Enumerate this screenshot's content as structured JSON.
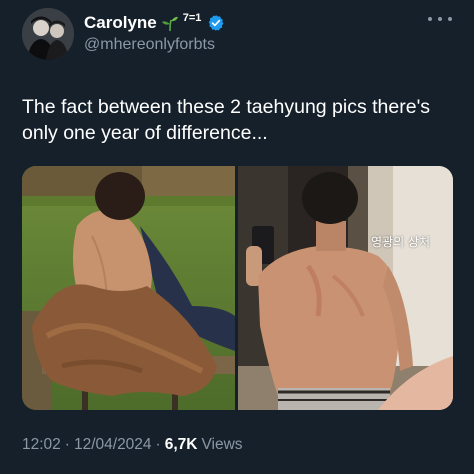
{
  "author": {
    "display_name": "Carolyne",
    "name_suffix": "7=1",
    "handle": "@mhereonlyforbts",
    "verified_color": "#1d9bf0"
  },
  "tweet": {
    "text": "The fact between these 2  taehyung pics there's only one year of difference...",
    "time": "12:02",
    "separator": "·",
    "date": "12/04/2024",
    "views_count": "6,7K",
    "views_label": "Views"
  },
  "media": {
    "right_photo_caption": "영광의 상처"
  },
  "colors": {
    "background": "#15202b",
    "text": "#ffffff",
    "secondary": "#8b98a5"
  },
  "icons": {
    "more": "more-horizontal-icon",
    "verified": "verified-badge-icon",
    "sprout": "sprout-emoji-icon"
  }
}
